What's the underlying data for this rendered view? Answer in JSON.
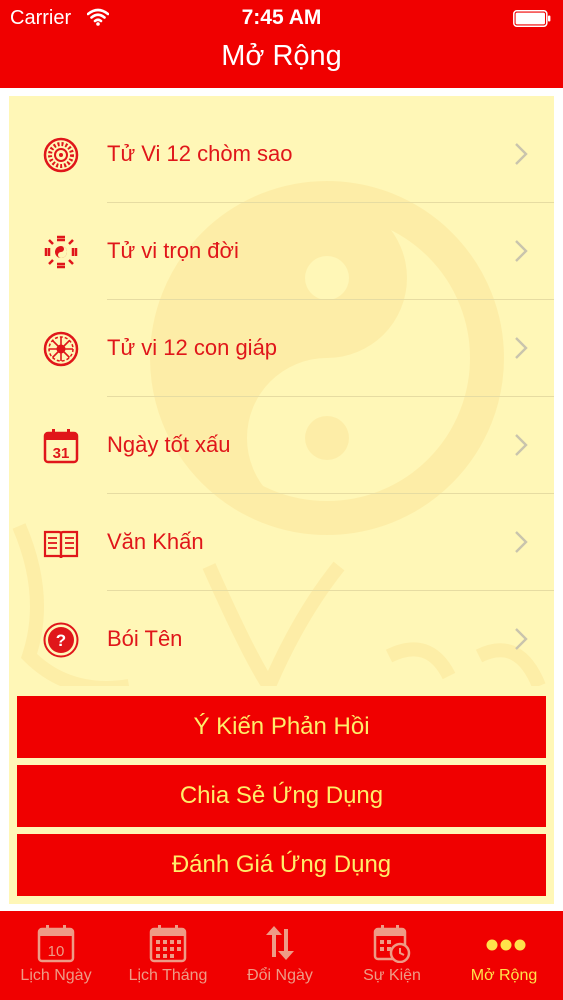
{
  "status_bar": {
    "carrier": "Carrier",
    "time": "7:45 AM"
  },
  "nav": {
    "title": "Mở Rộng"
  },
  "menu": {
    "items": [
      {
        "label": "Tử Vi 12 chòm sao",
        "icon": "zodiac-wheel-icon"
      },
      {
        "label": "Tử vi trọn đời",
        "icon": "bagua-icon"
      },
      {
        "label": "Tử vi 12 con giáp",
        "icon": "chinese-zodiac-icon"
      },
      {
        "label": "Ngày tốt xấu",
        "icon": "calendar-icon",
        "icon_text": "31"
      },
      {
        "label": "Văn Khấn",
        "icon": "book-icon"
      },
      {
        "label": "Bói Tên",
        "icon": "question-icon",
        "icon_text": "?"
      }
    ]
  },
  "actions": {
    "feedback": "Ý Kiến Phản Hồi",
    "share": "Chia Sẻ Ứng Dụng",
    "rate": "Đánh Giá Ứng Dụng"
  },
  "tabs": [
    {
      "label": "Lịch Ngày",
      "icon": "day-calendar-icon",
      "icon_text": "10"
    },
    {
      "label": "Lịch Tháng",
      "icon": "month-calendar-icon"
    },
    {
      "label": "Đổi Ngày",
      "icon": "swap-arrows-icon"
    },
    {
      "label": "Sự Kiện",
      "icon": "event-clock-icon"
    },
    {
      "label": "Mở Rộng",
      "icon": "more-dots-icon",
      "active": true
    }
  ],
  "colors": {
    "header_red": "#f00000",
    "content_cream": "#fff7b7",
    "label_red": "#e0161a",
    "button_text_yellow": "#ffee6a",
    "tab_active_yellow": "#ffe24a",
    "tab_inactive": "#ee9b86"
  }
}
